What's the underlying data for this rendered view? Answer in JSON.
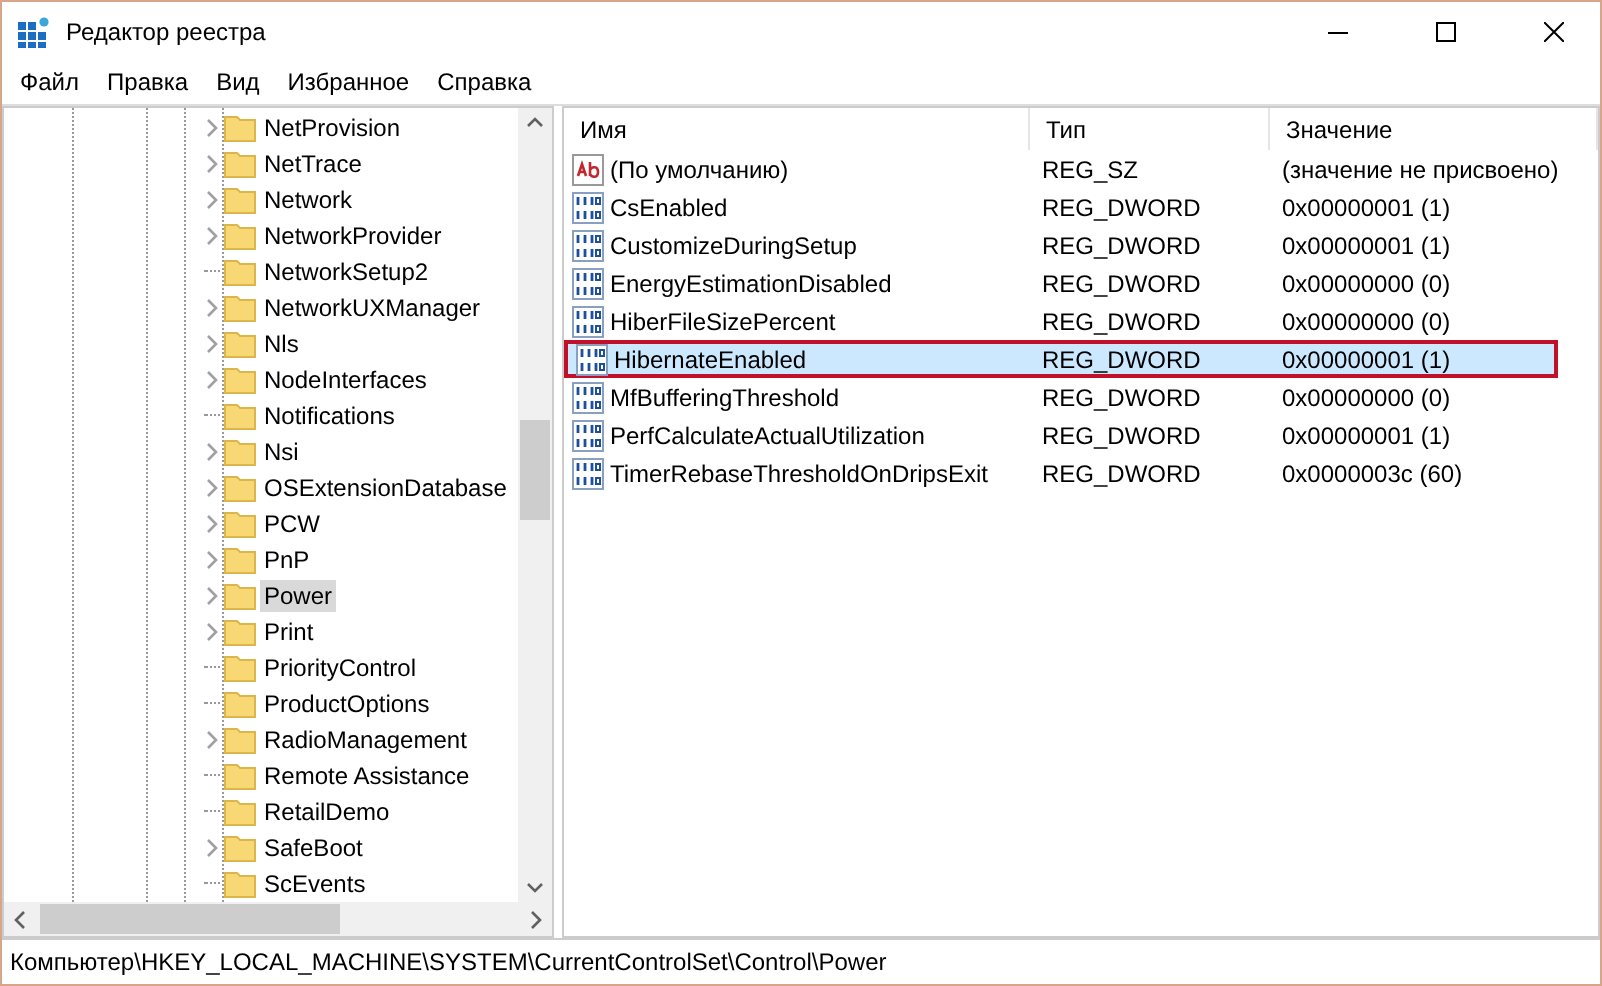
{
  "window": {
    "title": "Редактор реестра"
  },
  "menu": [
    "Файл",
    "Правка",
    "Вид",
    "Избранное",
    "Справка"
  ],
  "tree": {
    "items": [
      {
        "label": "NetProvision",
        "expandable": true,
        "selected": false
      },
      {
        "label": "NetTrace",
        "expandable": true,
        "selected": false
      },
      {
        "label": "Network",
        "expandable": true,
        "selected": false
      },
      {
        "label": "NetworkProvider",
        "expandable": true,
        "selected": false
      },
      {
        "label": "NetworkSetup2",
        "expandable": false,
        "selected": false
      },
      {
        "label": "NetworkUXManager",
        "expandable": true,
        "selected": false
      },
      {
        "label": "Nls",
        "expandable": true,
        "selected": false
      },
      {
        "label": "NodeInterfaces",
        "expandable": true,
        "selected": false
      },
      {
        "label": "Notifications",
        "expandable": false,
        "selected": false
      },
      {
        "label": "Nsi",
        "expandable": true,
        "selected": false
      },
      {
        "label": "OSExtensionDatabase",
        "expandable": true,
        "selected": false
      },
      {
        "label": "PCW",
        "expandable": true,
        "selected": false
      },
      {
        "label": "PnP",
        "expandable": true,
        "selected": false
      },
      {
        "label": "Power",
        "expandable": true,
        "selected": true
      },
      {
        "label": "Print",
        "expandable": true,
        "selected": false
      },
      {
        "label": "PriorityControl",
        "expandable": false,
        "selected": false
      },
      {
        "label": "ProductOptions",
        "expandable": false,
        "selected": false
      },
      {
        "label": "RadioManagement",
        "expandable": true,
        "selected": false
      },
      {
        "label": "Remote Assistance",
        "expandable": false,
        "selected": false
      },
      {
        "label": "RetailDemo",
        "expandable": false,
        "selected": false
      },
      {
        "label": "SafeBoot",
        "expandable": true,
        "selected": false
      },
      {
        "label": "ScEvents",
        "expandable": false,
        "selected": false
      }
    ]
  },
  "table": {
    "columns": [
      "Имя",
      "Тип",
      "Значение"
    ],
    "rows": [
      {
        "kind": "string",
        "name": "(По умолчанию)",
        "type": "REG_SZ",
        "value": "(значение не присвоено)",
        "selected": false,
        "outlined": false
      },
      {
        "kind": "dword",
        "name": "CsEnabled",
        "type": "REG_DWORD",
        "value": "0x00000001 (1)",
        "selected": false,
        "outlined": false
      },
      {
        "kind": "dword",
        "name": "CustomizeDuringSetup",
        "type": "REG_DWORD",
        "value": "0x00000001 (1)",
        "selected": false,
        "outlined": false
      },
      {
        "kind": "dword",
        "name": "EnergyEstimationDisabled",
        "type": "REG_DWORD",
        "value": "0x00000000 (0)",
        "selected": false,
        "outlined": false
      },
      {
        "kind": "dword",
        "name": "HiberFileSizePercent",
        "type": "REG_DWORD",
        "value": "0x00000000 (0)",
        "selected": false,
        "outlined": false
      },
      {
        "kind": "dword",
        "name": "HibernateEnabled",
        "type": "REG_DWORD",
        "value": "0x00000001 (1)",
        "selected": true,
        "outlined": true
      },
      {
        "kind": "dword",
        "name": "MfBufferingThreshold",
        "type": "REG_DWORD",
        "value": "0x00000000 (0)",
        "selected": false,
        "outlined": false
      },
      {
        "kind": "dword",
        "name": "PerfCalculateActualUtilization",
        "type": "REG_DWORD",
        "value": "0x00000001 (1)",
        "selected": false,
        "outlined": false
      },
      {
        "kind": "dword",
        "name": "TimerRebaseThresholdOnDripsExit",
        "type": "REG_DWORD",
        "value": "0x0000003c (60)",
        "selected": false,
        "outlined": false
      }
    ]
  },
  "status_bar": "Компьютер\\HKEY_LOCAL_MACHINE\\SYSTEM\\CurrentControlSet\\Control\\Power"
}
